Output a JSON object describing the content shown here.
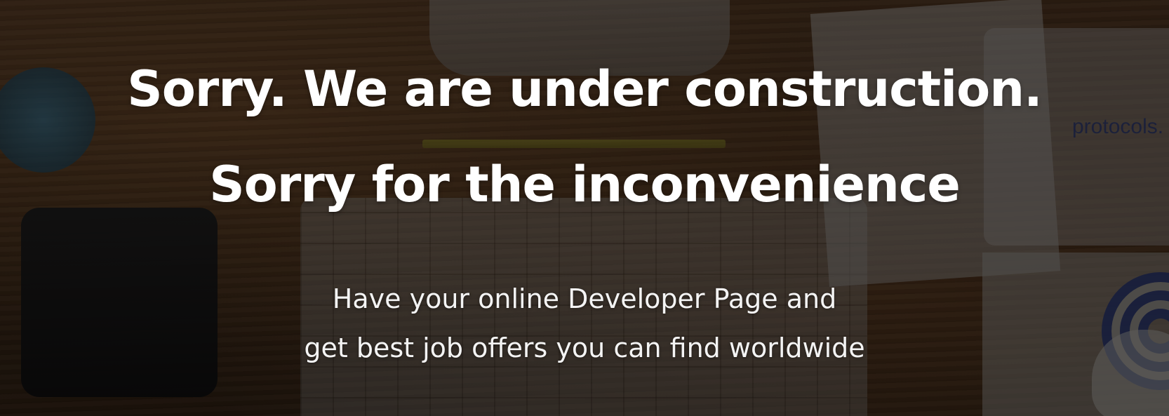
{
  "hero": {
    "headline_line1": "Sorry. We are under construction.",
    "headline_line2": "Sorry for the inconvenience",
    "subtext_line1": "Have your online Developer Page and",
    "subtext_line2": "get best job offers you can find worldwide",
    "background_text": "protocols.",
    "text_color": "#ffffff"
  }
}
